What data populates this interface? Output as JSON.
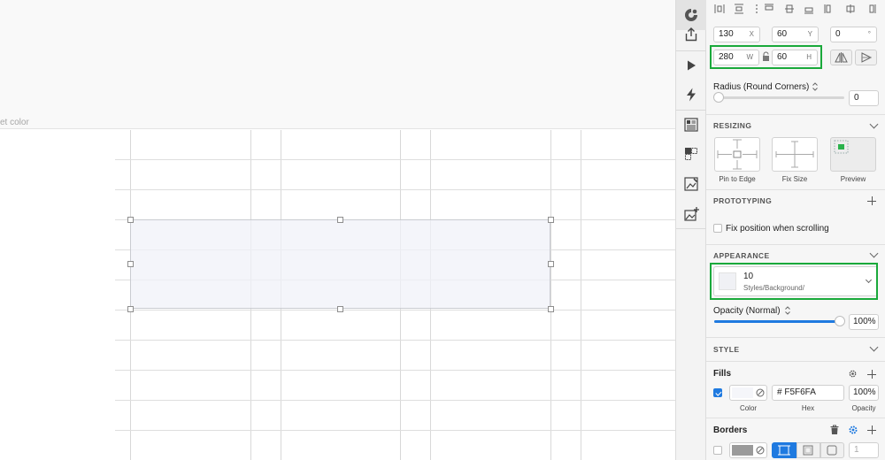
{
  "canvas": {
    "top_label": "et color"
  },
  "toolbar": {
    "icons": [
      "sketch-logo-icon",
      "export-icon",
      "play-icon",
      "lightning-icon",
      "document-icon",
      "symbols-icon",
      "edit-image-icon",
      "add-image-icon"
    ]
  },
  "inspector": {
    "position": {
      "x": "130",
      "x_label": "X",
      "y": "60",
      "y_label": "Y",
      "rotation": "0",
      "rotation_unit": "°"
    },
    "size": {
      "w": "280",
      "w_label": "W",
      "h": "60",
      "h_label": "H"
    },
    "radius": {
      "label": "Radius (Round Corners)",
      "value": "0"
    },
    "resizing": {
      "title": "RESIZING",
      "options": [
        {
          "label": "Pin to Edge"
        },
        {
          "label": "Fix Size"
        },
        {
          "label": "Preview"
        }
      ]
    },
    "prototyping": {
      "title": "PROTOTYPING",
      "fix_position_label": "Fix position when scrolling"
    },
    "appearance": {
      "title": "APPEARANCE",
      "style_name": "10",
      "style_path": "Styles/Background/",
      "opacity_label": "Opacity (Normal)",
      "opacity_value": "100%",
      "opacity_fraction": 1.0
    },
    "style": {
      "title": "STYLE"
    },
    "fills": {
      "title": "Fills",
      "hex": "# F5F6FA",
      "opacity": "100%",
      "color_label": "Color",
      "hex_label": "Hex",
      "opacity_label": "Opacity",
      "swatch_color": "#F5F6FA",
      "enabled": true
    },
    "borders": {
      "title": "Borders",
      "width_placeholder": "1",
      "swatch_color": "#9a9a9a"
    }
  },
  "colors": {
    "highlight": "#1aa93b",
    "accent": "#1f7ae0"
  }
}
